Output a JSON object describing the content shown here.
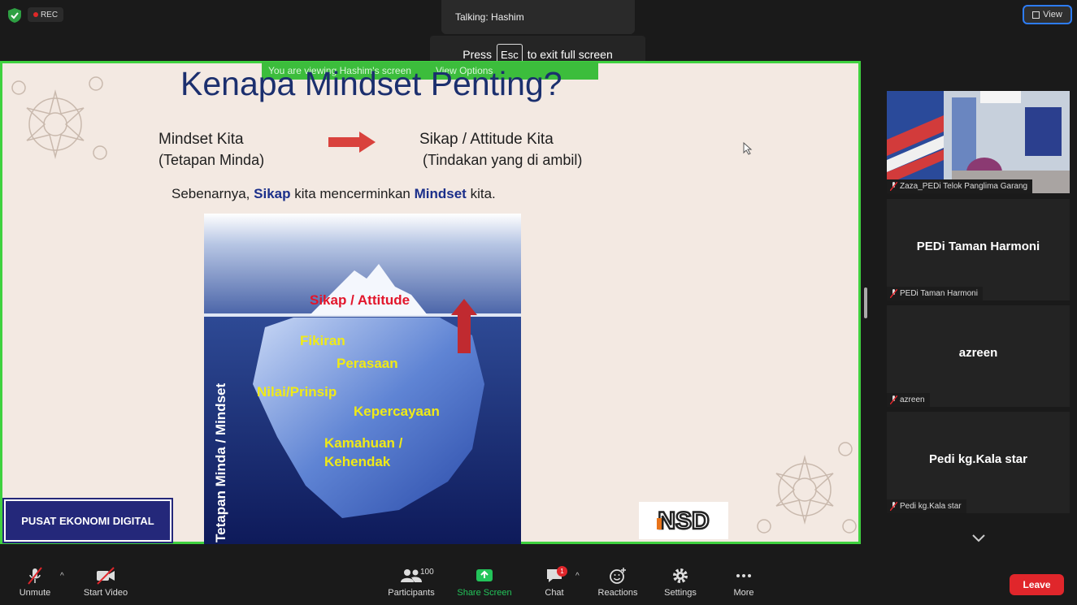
{
  "top": {
    "rec_label": "REC",
    "talking": "Talking: Hashim",
    "esc_before": "Press",
    "esc_key": "Esc",
    "esc_after": "to exit full screen",
    "view_label": "View"
  },
  "share": {
    "viewing": "You are viewing Hashim's screen",
    "view_options": "View Options"
  },
  "slide": {
    "title": "Kenapa Mindset Penting?",
    "left_1": "Mindset  Kita",
    "left_2": "(Tetapan Minda)",
    "right_1": "Sikap / Attitude Kita",
    "right_2": "(Tindakan yang di ambil)",
    "s_a": "Sebenarnya, ",
    "s_b": "Sikap",
    "s_c": " kita mencerminkan ",
    "s_d": "Mindset",
    "s_e": " kita.",
    "tip": "Sikap / Attitude",
    "items": [
      "Fikiran",
      "Perasaan",
      "Nilai/Prinsip",
      "Kepercayaan",
      "Kamahuan /",
      "Kehendak"
    ],
    "vertical": "Tetapan Minda / Mindset",
    "footer_left": "PUSAT EKONOMI DIGITAL",
    "logo": "NSD"
  },
  "participants": [
    {
      "tag": "Zaza_PEDi Telok Panglima Garang"
    },
    {
      "name": "PEDi Taman Harmoni",
      "tag": "PEDi Taman Harmoni"
    },
    {
      "name": "azreen",
      "tag": "azreen"
    },
    {
      "name": "Pedi kg.Kala star",
      "tag": "Pedi kg.Kala star"
    }
  ],
  "toolbar": {
    "unmute": "Unmute",
    "start_video": "Start Video",
    "participants": "Participants",
    "participants_count": "100",
    "share": "Share Screen",
    "chat": "Chat",
    "chat_badge": "1",
    "reactions": "Reactions",
    "settings": "Settings",
    "more": "More",
    "leave": "Leave"
  },
  "colors": {
    "accent_green": "#3fd13f",
    "leave_red": "#e0262b",
    "title_blue": "#1b2f6e",
    "view_border": "#2d7cf6"
  }
}
